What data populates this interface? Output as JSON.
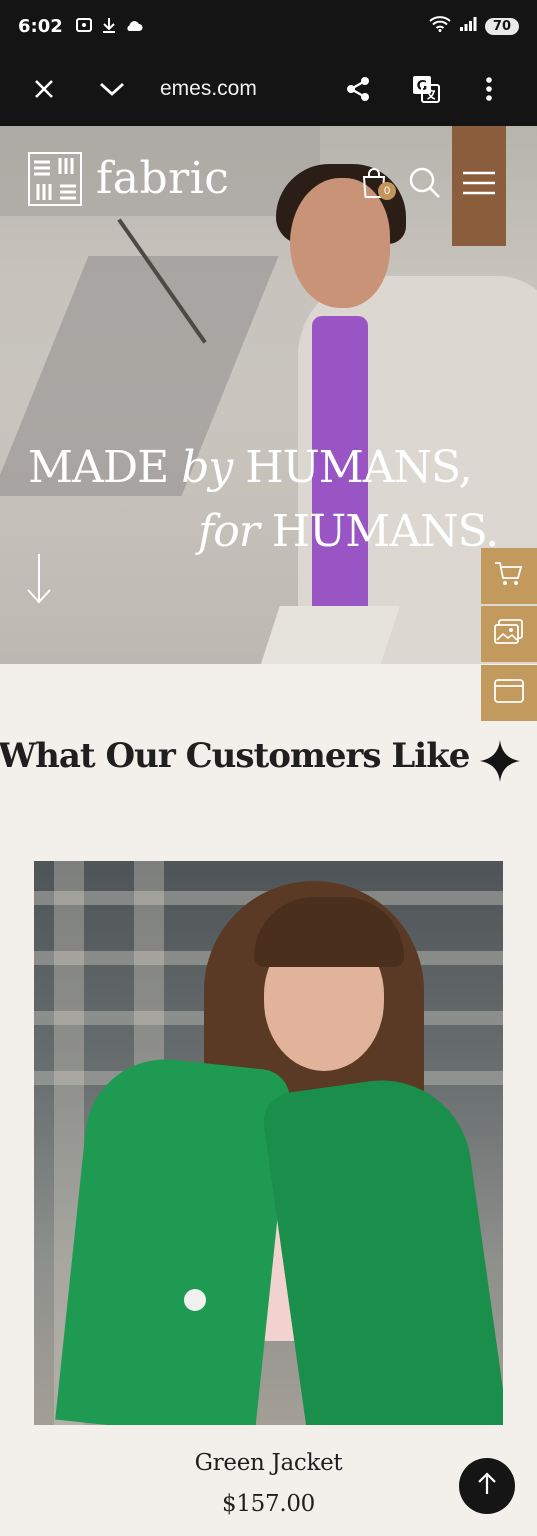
{
  "status_bar": {
    "time": "6:02",
    "battery": "70",
    "icons": [
      "screenshot-icon",
      "download-icon",
      "weather-icon",
      "wifi-icon",
      "signal-icon"
    ]
  },
  "browser": {
    "url": "emes.com",
    "icons": [
      "close-icon",
      "chevron-down-icon",
      "share-icon",
      "translate-icon",
      "more-icon"
    ]
  },
  "header": {
    "brand": "fabric",
    "cart_count": "0"
  },
  "hero": {
    "line1_a": "MADE ",
    "line1_b": "by",
    "line1_c": " HUMANS,",
    "line2_a": "for",
    "line2_b": " HUMANS."
  },
  "section": {
    "title": "What Our Customers Like"
  },
  "product": {
    "name": "Green Jacket",
    "price": "$157.00"
  },
  "colors": {
    "accent": "#c39a5d",
    "background": "#f3efea",
    "dark": "#141414"
  }
}
